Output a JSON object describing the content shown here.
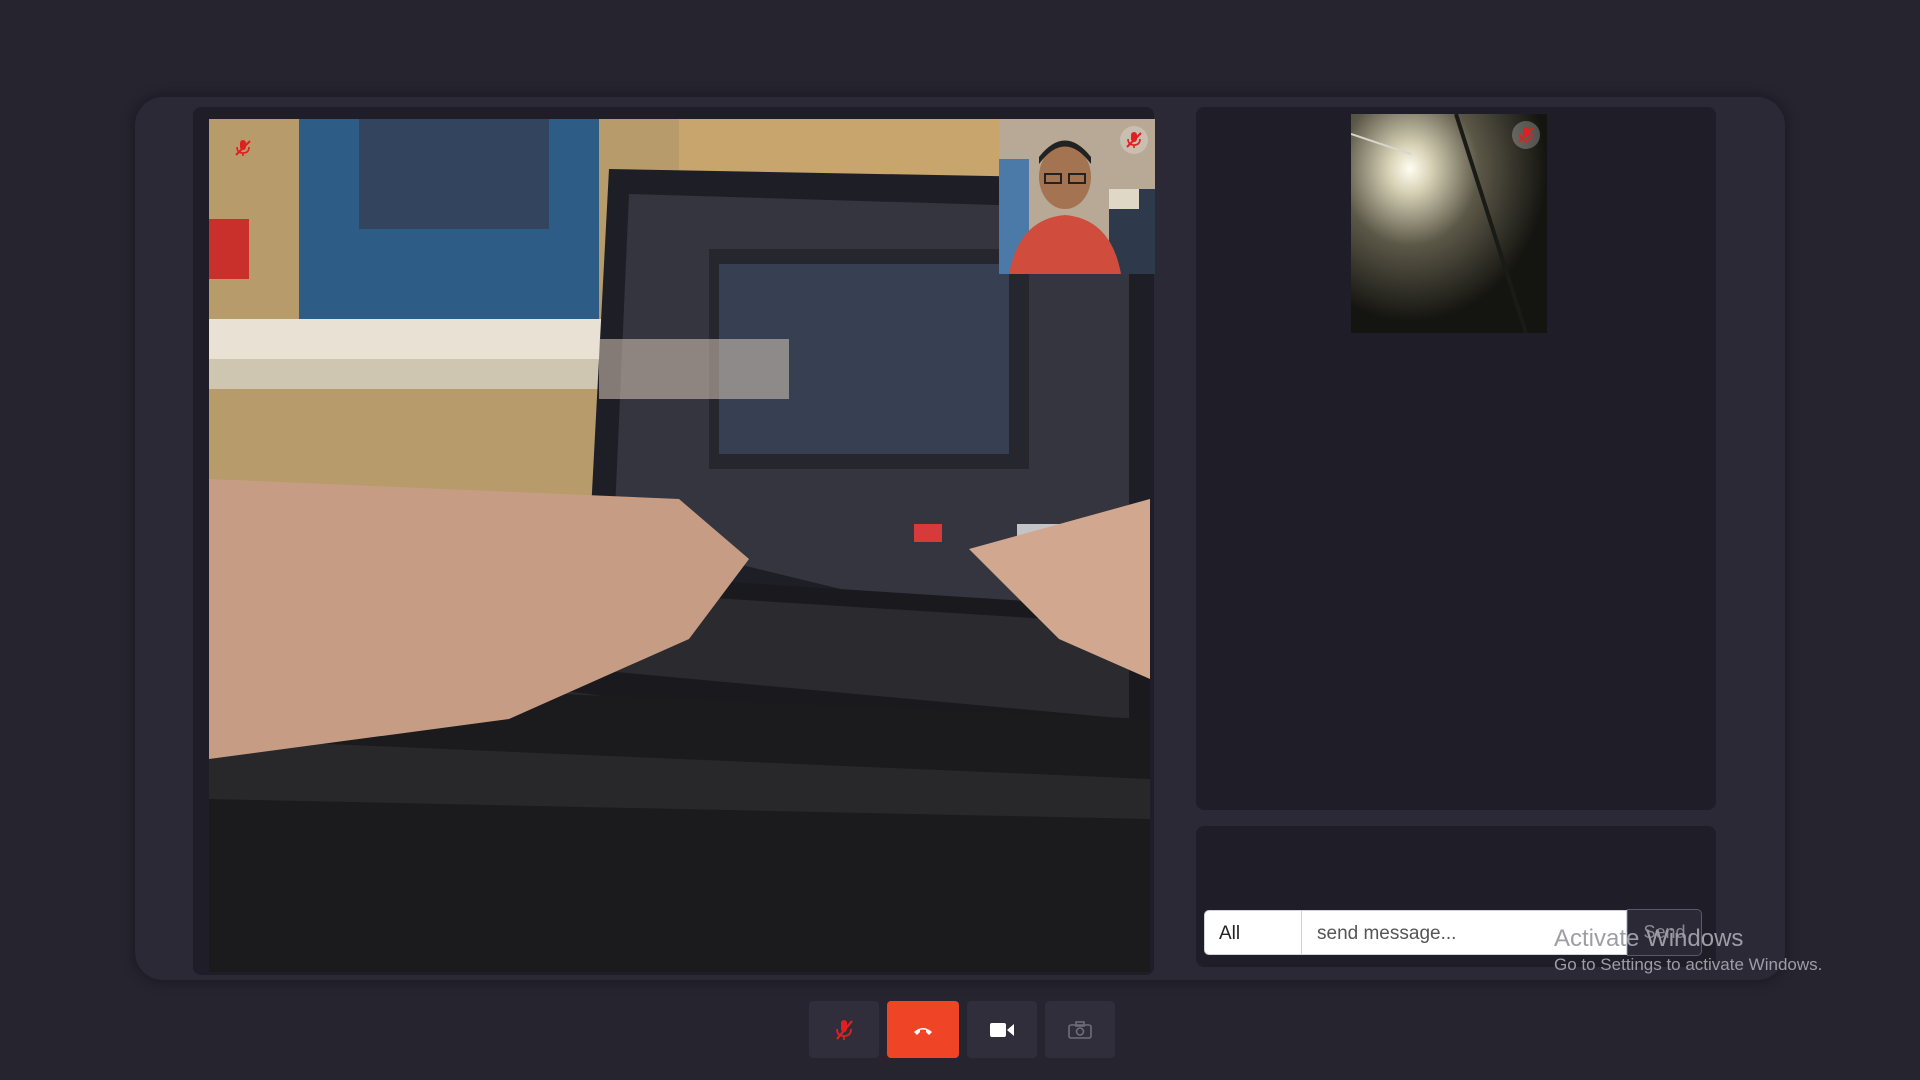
{
  "call": {
    "main_video": {
      "description_icon": "camera-feed",
      "mic_state": "muted",
      "mute_icon": "mic-off-icon"
    },
    "self_view": {
      "mic_state": "muted",
      "mute_icon": "mic-off-icon"
    },
    "participants": [
      {
        "mic_state": "muted",
        "mute_icon": "mic-off-icon"
      }
    ]
  },
  "chat": {
    "recipient_selected": "All",
    "message_placeholder": "send message...",
    "send_label": "Send"
  },
  "controls": {
    "mic_icon": "mic-off-icon",
    "end_call_icon": "phone-hangup-icon",
    "video_icon": "video-camera-icon",
    "snapshot_icon": "camera-icon",
    "end_call_color": "#ef4426"
  },
  "watermark": {
    "title": "Activate Windows",
    "subtitle": "Go to Settings to activate Windows."
  },
  "colors": {
    "background": "#25242f",
    "panel": "#1f1e28",
    "muted_red": "#e02020"
  }
}
